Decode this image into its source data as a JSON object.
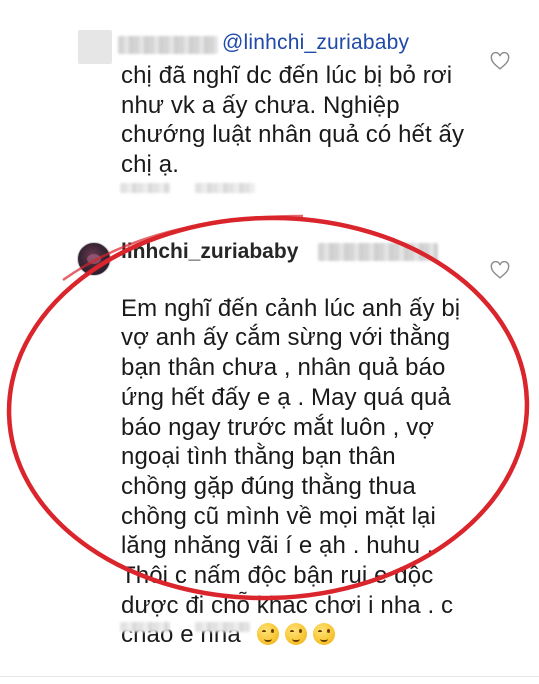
{
  "comments": [
    {
      "mention": "@linhchi_zuriababy",
      "text": "chị đã nghĩ dc đến lúc bị bỏ rơi\nnhư vk a ấy chưa. Nghiệp\nchướng luật nhân quả có hết ấy\nchị ạ.",
      "heart_icon": "heart-outline-icon"
    },
    {
      "username": "linhchi_zuriababy",
      "text": "Em nghĩ đến cảnh lúc anh ấy bị\nvợ anh ấy cắm sừng với thằng\nbạn thân chưa , nhân quả báo\nứng hết đấy e ạ . May quá quả\nbáo ngay trước mắt luôn , vợ\nngoại tình thằng bạn thân\nchồng gặp đúng thằng thua\nchồng cũ mình về mọi mặt lại\nlăng nhăng vãi í e ạh . huhu .\nThôi c nấm độc bận rui e độc\ndược đi chỗ khác chơi i nha . c\nchao e nha",
      "emojis": [
        "wink-emoji",
        "wink-emoji",
        "wink-emoji"
      ],
      "heart_icon": "heart-outline-icon"
    }
  ],
  "colors": {
    "mention": "#1f4aa8",
    "highlight_circle": "#d9252b",
    "text": "#1a1a1a"
  }
}
